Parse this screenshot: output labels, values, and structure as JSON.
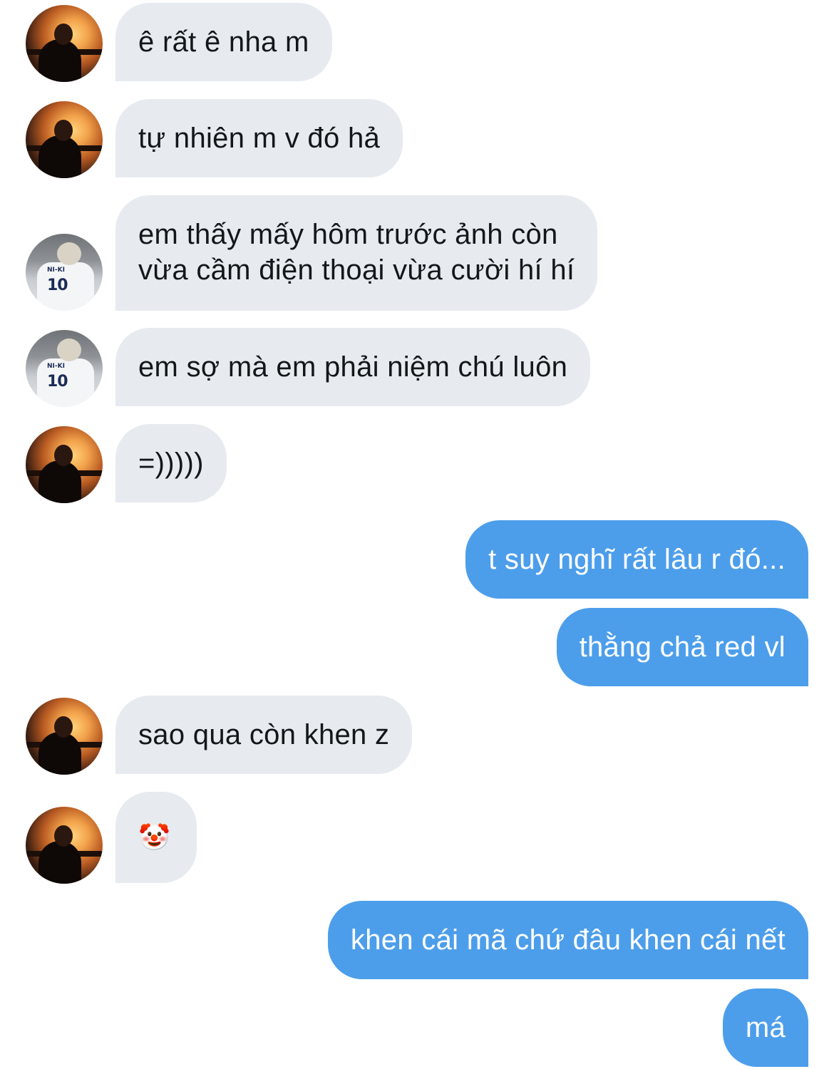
{
  "conversation": {
    "messages": [
      {
        "text": "ê rất ê nha m"
      },
      {
        "text": "tự nhiên m v đó hả"
      },
      {
        "text": "em thấy mấy hôm trước ảnh còn",
        "text2": "vừa cầm điện thoại vừa cười hí hí"
      },
      {
        "text": "em sợ mà em phải niệm chú luôn"
      },
      {
        "text": "=)))))"
      },
      {
        "text": "t suy nghĩ rất lâu r đó..."
      },
      {
        "text": "thằng chả red vl"
      },
      {
        "text": "sao qua còn khen z"
      },
      {
        "text": "🤡"
      },
      {
        "text": "khen cái mã chứ đâu khen cái nết"
      },
      {
        "text": "má"
      }
    ],
    "avatars": {
      "sunset": {
        "icon": "person-sunset-avatar"
      },
      "jersey": {
        "icon": "person-jersey-avatar",
        "jersey_name": "NI-KI",
        "jersey_number": "10"
      }
    },
    "colors": {
      "incoming_bubble": "#e7ebef",
      "outgoing_bubble": "#4c9eeb",
      "incoming_text": "#14171a",
      "outgoing_text": "#ffffff"
    }
  }
}
